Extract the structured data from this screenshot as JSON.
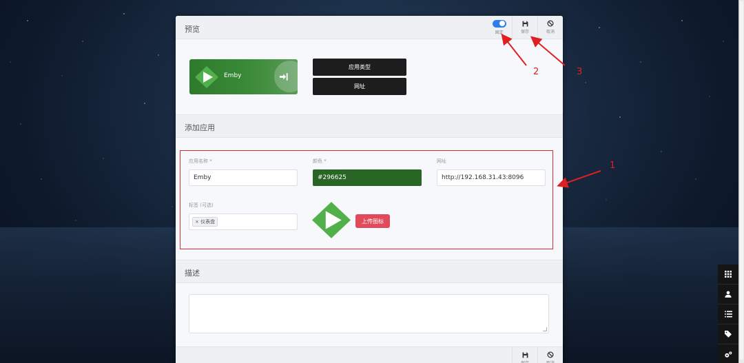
{
  "preview": {
    "title": "预览",
    "pin_label": "固定",
    "save_label": "保存",
    "cancel_label": "取消",
    "tile_name": "Emby",
    "app_type_button": "应用类型",
    "url_button": "网址"
  },
  "add_app": {
    "title": "添加应用",
    "name_label": "应用名称 *",
    "name_value": "Emby",
    "color_label": "颜色 *",
    "color_value": "#296625",
    "url_label": "网址",
    "url_value": "http://192.168.31.43:8096",
    "tags_label": "标签 (可选)",
    "tag_value": "× 仪表盘",
    "upload_button": "上传图标"
  },
  "description": {
    "title": "描述",
    "value": ""
  },
  "footer": {
    "save_label": "保存",
    "cancel_label": "取消"
  },
  "annotations": {
    "one": "1",
    "two": "2",
    "three": "3"
  },
  "colors": {
    "app_color": "#296625",
    "accent_blue": "#2d7cf0",
    "upload_red": "#e04a5a",
    "annotation_red": "#e02020"
  },
  "icons": {
    "tile_icon": "emby-logo-icon",
    "launch_icon": "arrow-right-to-bracket-icon",
    "save_icon": "floppy-disk-icon",
    "cancel_icon": "ban-icon",
    "dock": [
      "grid-icon",
      "user-icon",
      "list-icon",
      "tag-icon",
      "gears-icon"
    ]
  }
}
